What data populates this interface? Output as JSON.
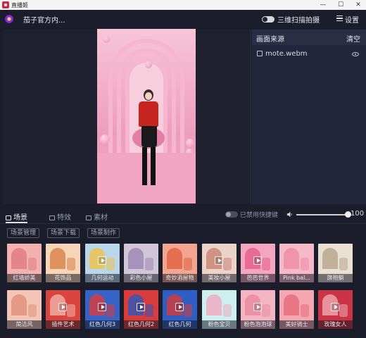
{
  "window": {
    "title": "直播姬",
    "controls": {
      "minimize": "—",
      "maximize": "☐",
      "close": "✕"
    }
  },
  "header": {
    "channel_name": "茄子官方内...",
    "mode_toggle_label": "三维扫描拍摄",
    "settings_label": "设置"
  },
  "sources_panel": {
    "title": "画面来源",
    "clear_label": "清空",
    "items": [
      {
        "name": "mote.webm",
        "visible": true
      }
    ]
  },
  "tabs": [
    {
      "label": "场景",
      "active": true
    },
    {
      "label": "特效",
      "active": false
    },
    {
      "label": "素材",
      "active": false
    }
  ],
  "hotkey": {
    "label": "已禁用快捷键",
    "enabled": false
  },
  "volume": {
    "value": 100
  },
  "subtabs": [
    "场景管理",
    "场景下载",
    "场景制作"
  ],
  "scenes": [
    {
      "label": "红墙娇美",
      "bg": "#f1b2b0",
      "accent": "#e07b80",
      "play": false
    },
    {
      "label": "花饰品",
      "bg": "#f6d5b8",
      "accent": "#d97f47",
      "play": false
    },
    {
      "label": "几何运动",
      "bg": "#b9d6ea",
      "accent": "#f0c34a",
      "play": true
    },
    {
      "label": "彩色小屋",
      "bg": "#d0c6d8",
      "accent": "#9c86b2",
      "play": false
    },
    {
      "label": "奇妙酒屋物",
      "bg": "#f2a590",
      "accent": "#e0603f",
      "play": false
    },
    {
      "label": "美妆小屋",
      "bg": "#ecd3c9",
      "accent": "#c88272",
      "play": true
    },
    {
      "label": "芭芭世界",
      "bg": "#f3a6bf",
      "accent": "#e45c8a",
      "play": true
    },
    {
      "label": "Pink bal...",
      "bg": "#f5b9c9",
      "accent": "#ef89a6",
      "play": false
    },
    {
      "label": "旗袍躺",
      "bg": "#e8e0d2",
      "accent": "#b5a48a",
      "play": false
    },
    {
      "label": "简洁风",
      "bg": "#f2c5b7",
      "accent": "#de8f7a",
      "play": false
    },
    {
      "label": "插件艺术",
      "bg": "#d9443f",
      "accent": "#f0b3a8",
      "play": true
    },
    {
      "label": "红色几何3",
      "bg": "#3563c7",
      "accent": "#e03a3a",
      "play": true
    },
    {
      "label": "红色几何2",
      "bg": "#d93c3c",
      "accent": "#2c58b9",
      "play": true
    },
    {
      "label": "红色几何",
      "bg": "#2f5fc4",
      "accent": "#d83a3a",
      "play": true
    },
    {
      "label": "粉色宝贝",
      "bg": "#cdeff0",
      "accent": "#f1a7bf",
      "play": false
    },
    {
      "label": "粉色泡泡球",
      "bg": "#f2b5c1",
      "accent": "#e98aa0",
      "play": true
    },
    {
      "label": "美好骑士",
      "bg": "#f4a7b1",
      "accent": "#e66c7e",
      "play": false
    },
    {
      "label": "玫瑰女人",
      "bg": "#c93446",
      "accent": "#f1aab3",
      "play": true
    }
  ]
}
